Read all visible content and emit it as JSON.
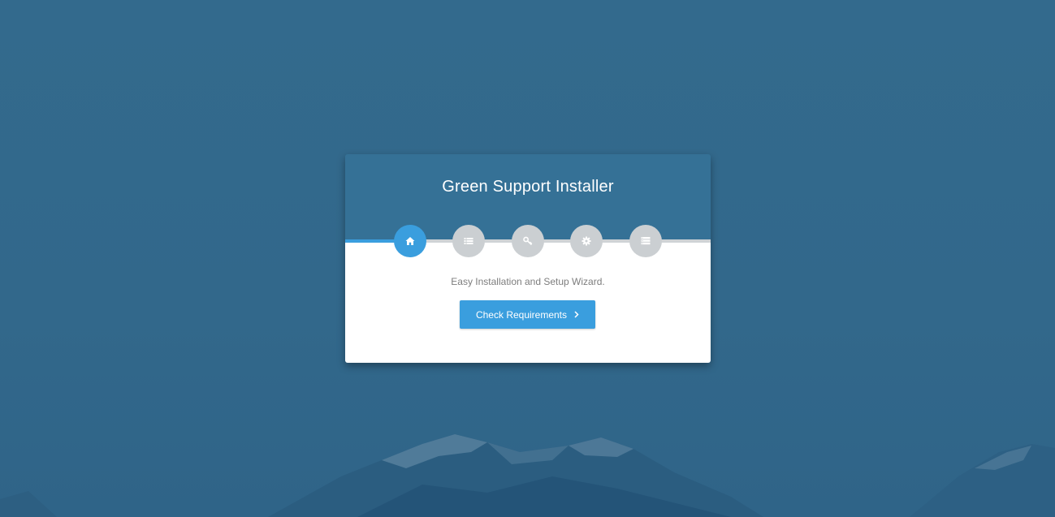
{
  "installer": {
    "title": "Green Support Installer",
    "subtitle": "Easy Installation and Setup Wizard.",
    "primary_button_label": "Check Requirements",
    "steps": [
      {
        "icon": "home-icon",
        "active": true
      },
      {
        "icon": "list-icon",
        "active": false
      },
      {
        "icon": "key-icon",
        "active": false
      },
      {
        "icon": "gear-icon",
        "active": false
      },
      {
        "icon": "server-icon",
        "active": false
      }
    ]
  },
  "colors": {
    "background": "#34678a",
    "header": "#357196",
    "accent": "#3a9ede",
    "inactive_step": "#cbcfd2",
    "card_body": "#ffffff",
    "subtitle_text": "#7d7d7d"
  }
}
